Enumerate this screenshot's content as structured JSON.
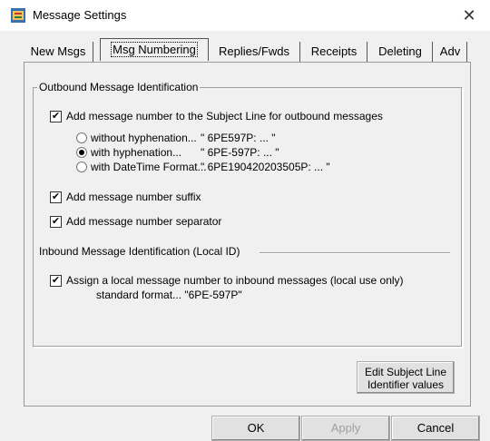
{
  "window": {
    "title": "Message Settings",
    "close_glyph": "✕",
    "app_icon": "settings-app-icon"
  },
  "tabs": [
    {
      "label": "New Msgs",
      "active": false
    },
    {
      "label": "Msg Numbering",
      "active": true
    },
    {
      "label": "Replies/Fwds",
      "active": false
    },
    {
      "label": "Receipts",
      "active": false
    },
    {
      "label": "Deleting",
      "active": false
    },
    {
      "label": "Adv",
      "active": false
    }
  ],
  "outbound": {
    "legend": "Outbound Message Identification",
    "add_subject": {
      "label": "Add message number to the Subject Line for outbound messages",
      "checked": true
    },
    "options": [
      {
        "label": "without hyphenation...",
        "example": "\" 6PE597P: ... \"",
        "selected": false
      },
      {
        "label": "with hyphenation...",
        "example": "\" 6PE-597P: ... \"",
        "selected": true
      },
      {
        "label": "with DateTime Format...",
        "example": "\" 6PE190420203505P: ... \"",
        "selected": false
      }
    ],
    "suffix": {
      "label": "Add message number suffix",
      "checked": true
    },
    "separator": {
      "label": "Add message number separator",
      "checked": true
    }
  },
  "inbound": {
    "legend": "Inbound Message Identification (Local ID)",
    "assign": {
      "label": "Assign a local message number to inbound messages (local use only)",
      "checked": true
    },
    "format_text": "standard format...  \"6PE-597P\""
  },
  "buttons": {
    "edit_line1": "Edit Subject Line",
    "edit_line2": "Identifier values",
    "ok": "OK",
    "apply": "Apply",
    "cancel": "Cancel"
  },
  "check_glyph": "✔"
}
